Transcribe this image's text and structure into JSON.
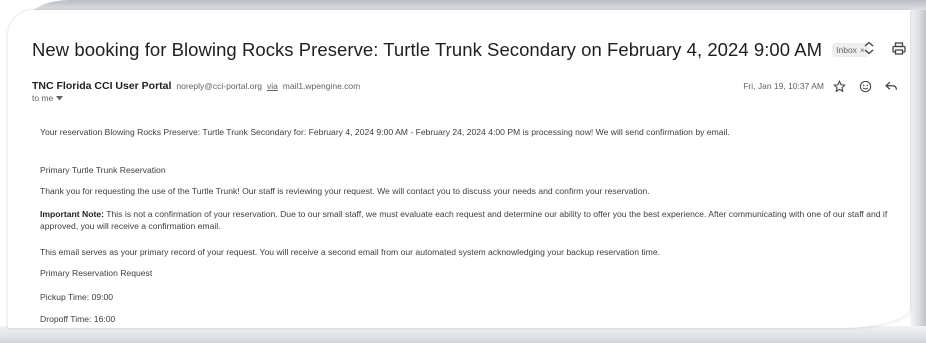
{
  "email": {
    "subject": "New booking for Blowing Rocks Preserve: Turtle Trunk Secondary on February 4, 2024 9:00 AM",
    "label_chip": "Inbox",
    "label_close": "×",
    "sender_name": "TNC Florida CCI User Portal",
    "sender_email": "noreply@cci-portal.org",
    "via_text": "via",
    "via_domain": "mail1.wpengine.com",
    "to_text": "to me",
    "date": "Fri, Jan 19, 10:37 AM",
    "body": {
      "p1": "Your reservation Blowing Rocks Preserve: Turtle Trunk Secondary for: February 4, 2024 9:00 AM - February 24, 2024 4:00 PM is processing now! We will send confirmation by email.",
      "p2": "Primary Turtle Trunk Reservation",
      "p3": "Thank you for requesting the use of the Turtle Trunk! Our staff is reviewing your request. We will contact you to discuss your needs and confirm your reservation.",
      "p4_bold": "Important Note:",
      "p4_rest": "This is not a confirmation of your reservation. Due to our small staff, we must evaluate each request and determine our ability to offer you the best experience. After communicating with one of our staff and if approved, you will receive a confirmation email.",
      "p5": "This email serves as your primary record of your request. You will receive a second email from our automated system acknowledging your backup reservation time.",
      "p6": "Primary Reservation Request",
      "p7": "Pickup Time: 09:00",
      "p8": "Dropoff Time: 16:00"
    }
  },
  "icons": {
    "expand": "expand-collapse-icon",
    "print": "print-icon",
    "star": "star-icon",
    "emoji": "emoji-reaction-icon",
    "reply": "reply-icon",
    "to_dropdown": "chevron-down-icon"
  },
  "colors": {
    "text_primary": "#1f1f1f",
    "text_secondary": "#5f6368",
    "chip_bg": "#eeeeee"
  }
}
